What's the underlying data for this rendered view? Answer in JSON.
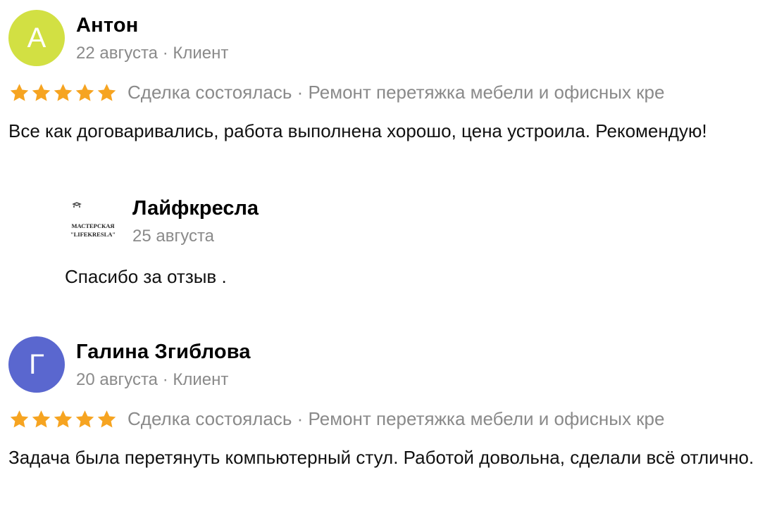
{
  "colors": {
    "star": "#f6a421",
    "meta_gray": "#8a8a8a",
    "avatar_anton": "#d2e043",
    "avatar_galina": "#5a67cf"
  },
  "reviews": [
    {
      "avatar_letter": "А",
      "author": "Антон",
      "date": "22 августа",
      "separator": "·",
      "role": "Клиент",
      "stars": 5,
      "deal": "Сделка состоялась · Ремонт перетяжка мебели и офисных кре",
      "text": "Все как договаривались, работа выполнена хорошо, цена устроила. Рекомендую!",
      "reply": {
        "logo_text_line1": "МАСТЕРСКАЯ",
        "logo_text_line2": "\"LIFEKRESLA\"",
        "name": "Лайфкресла",
        "date": "25 августа",
        "text": "Спасибо за отзыв ."
      }
    },
    {
      "avatar_letter": "Г",
      "author": "Галина Згиблова",
      "date": "20 августа",
      "separator": "·",
      "role": "Клиент",
      "stars": 5,
      "deal": "Сделка состоялась · Ремонт перетяжка мебели и офисных кре",
      "text": "Задача была перетянуть компьютерный стул. Работой довольна, сделали всё отлично."
    }
  ]
}
